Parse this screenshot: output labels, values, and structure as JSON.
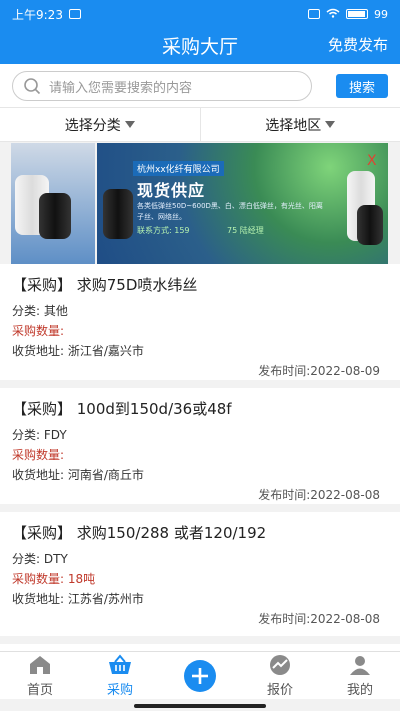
{
  "status": {
    "time": "上午9:23",
    "battery": "99"
  },
  "header": {
    "title": "采购大厅",
    "action": "免费发布"
  },
  "search": {
    "placeholder": "请输入您需要搜索的内容",
    "button": "搜索"
  },
  "filters": [
    {
      "label": "选择分类"
    },
    {
      "label": "选择地区"
    }
  ],
  "banner": {
    "company": "杭州xx化纤有限公司",
    "headline": "现货供应",
    "desc": "各类低弹丝50D~600D黑、白、漂白低弹丝，有光丝、阳离子丝、网络丝。",
    "contact": "联系方式: 159",
    "contact2": "75 陆经理",
    "close": "X"
  },
  "items": [
    {
      "title": "【采购】 求购75D喷水纬丝",
      "category_label": "分类:",
      "category": "其他",
      "qty_label": "采购数量:",
      "qty": "",
      "address_label": "收货地址:",
      "address": "浙江省/嘉兴市",
      "date_label": "发布时间:",
      "date": "2022-08-09"
    },
    {
      "title": "【采购】 100d到150d/36或48f",
      "category_label": "分类:",
      "category": "FDY",
      "qty_label": "采购数量:",
      "qty": "",
      "address_label": "收货地址:",
      "address": "河南省/商丘市",
      "date_label": "发布时间:",
      "date": "2022-08-08"
    },
    {
      "title": "【采购】 求购150/288 或者120/192",
      "category_label": "分类:",
      "category": "DTY",
      "qty_label": "采购数量:",
      "qty": "18吨",
      "address_label": "收货地址:",
      "address": "江苏省/苏州市",
      "date_label": "发布时间:",
      "date": "2022-08-08"
    }
  ],
  "tabs": [
    {
      "label": "首页",
      "icon": "home-icon"
    },
    {
      "label": "采购",
      "icon": "basket-icon"
    },
    {
      "label": "",
      "icon": "plus-icon"
    },
    {
      "label": "报价",
      "icon": "trend-icon"
    },
    {
      "label": "我的",
      "icon": "user-icon"
    }
  ],
  "colors": {
    "primary": "#1a8cf0",
    "qty": "#c0392b"
  }
}
